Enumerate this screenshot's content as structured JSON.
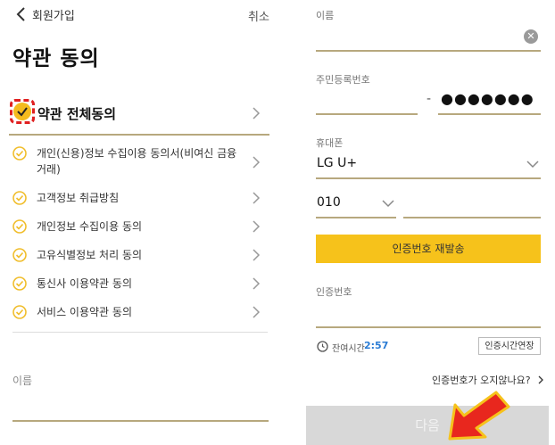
{
  "left": {
    "header": {
      "title": "회원가입",
      "cancel": "취소"
    },
    "page_title": "약관 동의",
    "all_agree": "약관 전체동의",
    "terms": [
      {
        "label_line1": "개인(신용)정보 수집이용 동의서(비여신 금융",
        "label_line2": "거래)"
      },
      {
        "label_line1": "고객정보 취급방침"
      },
      {
        "label_line1": "개인정보 수집이용 동의"
      },
      {
        "label_line1": "고유식별정보 처리 동의"
      },
      {
        "label_line1": "통신사 이용약관 동의"
      },
      {
        "label_line1": "서비스 이용약관 동의"
      }
    ],
    "name_label": "이름"
  },
  "right": {
    "name_label": "이름",
    "rrn_label": "주민등록번호",
    "rrn_dash": "-",
    "rrn_masked": "●●●●●●●",
    "phone_label": "휴대폰",
    "carrier": "LG U+",
    "prefix": "010",
    "resend_button": "인증번호 재발송",
    "code_label": "인증번호",
    "timer_label": "잔여시간",
    "timer_value": "2:57",
    "extend_button": "인증시간연장",
    "not_received": "인증번호가 오지않나요?",
    "next_button": "다음"
  },
  "colors": {
    "accent": "#f6c21b",
    "underline": "#b7a87e",
    "timer": "#2a7bd4",
    "annotation": "#e02020"
  }
}
